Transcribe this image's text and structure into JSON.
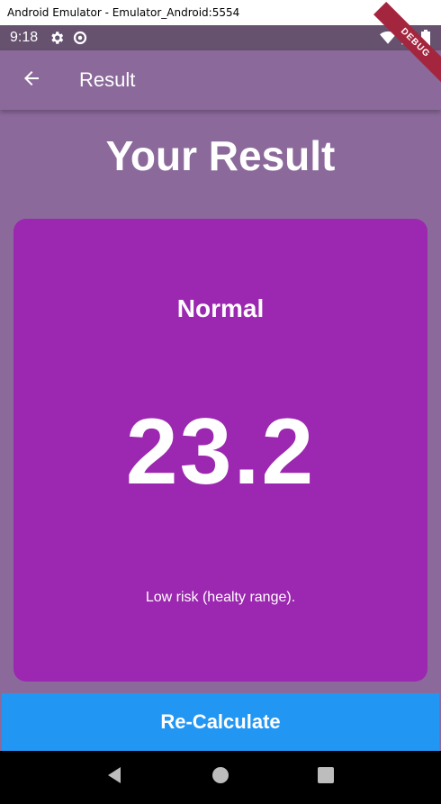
{
  "window": {
    "title": "Android Emulator - Emulator_Android:5554"
  },
  "status_bar": {
    "time": "9:18"
  },
  "app_bar": {
    "title": "Result"
  },
  "debug_banner": "DEBUG",
  "page": {
    "heading": "Your Result",
    "result": {
      "status": "Normal",
      "bmi": "23.2",
      "interpretation": "Low risk (healty range)."
    },
    "recalculate_label": "Re-Calculate"
  },
  "colors": {
    "background": "#8b6a9b",
    "card": "#9c27b0",
    "button": "#2196f3",
    "debug_banner": "#a3263e"
  },
  "icons": {
    "back": "arrow-back-icon",
    "settings": "gear-icon",
    "sync": "sync-icon",
    "wifi": "wifi-icon",
    "signal": "signal-icon",
    "battery": "battery-icon",
    "nav_back": "triangle-back-icon",
    "nav_home": "circle-home-icon",
    "nav_recent": "square-recent-icon"
  }
}
